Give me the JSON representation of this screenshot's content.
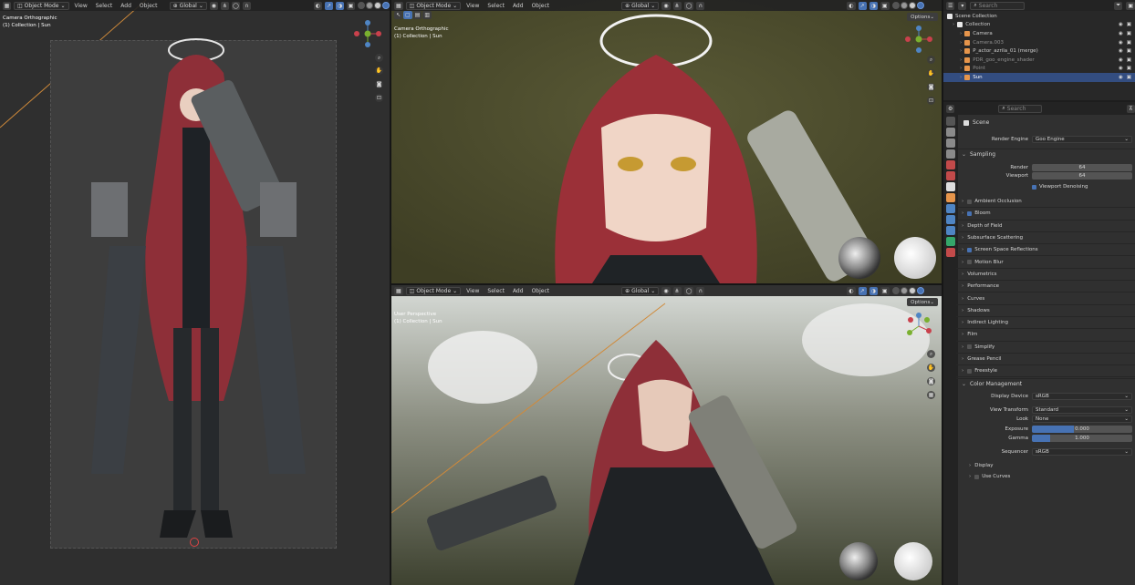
{
  "viewport_header": {
    "mode": "Object Mode",
    "menus": [
      "View",
      "Select",
      "Add",
      "Object"
    ],
    "transform_orientation": "Global",
    "options_label": "Options"
  },
  "viewports": {
    "left": {
      "line1": "Camera Orthographic",
      "line2": "(1) Collection | Sun"
    },
    "top_right": {
      "line1": "Camera Orthographic",
      "line2": "(1) Collection | Sun"
    },
    "bottom_right": {
      "line1": "User Perspective",
      "line2": "(1) Collection | Sun"
    }
  },
  "outliner": {
    "search_placeholder": "Search",
    "root": "Scene Collection",
    "items": [
      {
        "label": "Collection",
        "indent": 0,
        "color": "#cccccc",
        "icon_color": "#e8e8e8",
        "selected": false
      },
      {
        "label": "Camera",
        "indent": 1,
        "color": "#cccccc",
        "icon_color": "#e6954b",
        "selected": false
      },
      {
        "label": "Camera.003",
        "indent": 1,
        "color": "#8f8f8f",
        "icon_color": "#e6954b",
        "selected": false
      },
      {
        "label": "P_actor_azrila_01 (merge)",
        "indent": 1,
        "color": "#cccccc",
        "icon_color": "#e6954b",
        "selected": false
      },
      {
        "label": "PDR_goo_engine_shader",
        "indent": 1,
        "color": "#8f8f8f",
        "icon_color": "#e6954b",
        "selected": false
      },
      {
        "label": "Point",
        "indent": 1,
        "color": "#8f8f8f",
        "icon_color": "#e6954b",
        "selected": false
      },
      {
        "label": "Sun",
        "indent": 1,
        "color": "#ffffff",
        "icon_color": "#e6954b",
        "selected": true
      }
    ]
  },
  "properties": {
    "search_placeholder": "Search",
    "scene_label": "Scene",
    "render_engine_label": "Render Engine",
    "render_engine_value": "Goo Engine",
    "sampling": {
      "header": "Sampling",
      "render_label": "Render",
      "render_value": "64",
      "viewport_label": "Viewport",
      "viewport_value": "64",
      "denoise_label": "Viewport Denoising"
    },
    "panels": [
      {
        "label": "Ambient Occlusion",
        "checkbox": true,
        "checked": false
      },
      {
        "label": "Bloom",
        "checkbox": true,
        "checked": true
      },
      {
        "label": "Depth of Field",
        "checkbox": false,
        "checked": false
      },
      {
        "label": "Subsurface Scattering",
        "checkbox": false,
        "checked": false
      },
      {
        "label": "Screen Space Reflections",
        "checkbox": true,
        "checked": true
      },
      {
        "label": "Motion Blur",
        "checkbox": true,
        "checked": false
      },
      {
        "label": "Volumetrics",
        "checkbox": false,
        "checked": false
      },
      {
        "label": "Performance",
        "checkbox": false,
        "checked": false
      },
      {
        "label": "Curves",
        "checkbox": false,
        "checked": false
      },
      {
        "label": "Shadows",
        "checkbox": false,
        "checked": false
      },
      {
        "label": "Indirect Lighting",
        "checkbox": false,
        "checked": false
      },
      {
        "label": "Film",
        "checkbox": false,
        "checked": false
      },
      {
        "label": "Simplify",
        "checkbox": true,
        "checked": false
      },
      {
        "label": "Grease Pencil",
        "checkbox": false,
        "checked": false
      },
      {
        "label": "Freestyle",
        "checkbox": true,
        "checked": false
      }
    ],
    "color_management": {
      "header": "Color Management",
      "display_device_label": "Display Device",
      "display_device_value": "sRGB",
      "view_transform_label": "View Transform",
      "view_transform_value": "Standard",
      "look_label": "Look",
      "look_value": "None",
      "exposure_label": "Exposure",
      "exposure_value": "0.000",
      "gamma_label": "Gamma",
      "gamma_value": "1.000",
      "sequencer_label": "Sequencer",
      "sequencer_value": "sRGB",
      "display_label": "Display",
      "use_curves_label": "Use Curves"
    }
  },
  "colors": {
    "accent_blue": "#4772b3",
    "selected_row": "#334d80",
    "panel_bg": "#303030",
    "header_bg": "#232323"
  }
}
